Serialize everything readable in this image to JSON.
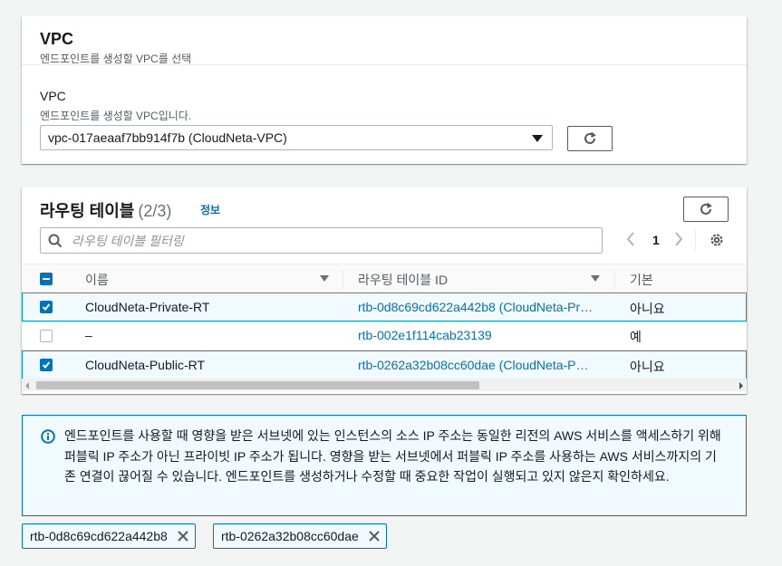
{
  "vpc_section": {
    "title": "VPC",
    "description": "엔드포인트를 생성할 VPC를 선택",
    "field_label": "VPC",
    "field_description": "엔드포인트를 생성할 VPC입니다.",
    "selected_vpc": "vpc-017aeaaf7bb914f7b (CloudNeta-VPC)"
  },
  "route_tables": {
    "title": "라우팅 테이블",
    "count": "(2/3)",
    "info_link": "정보",
    "search_placeholder": "라우팅 테이블 필터링",
    "current_page": "1",
    "columns": [
      "이름",
      "라우팅 테이블 ID",
      "기본"
    ],
    "rows": [
      {
        "checked": true,
        "name": "CloudNeta-Private-RT",
        "id": "rtb-0d8c69cd622a442b8 (CloudNeta-Pr…",
        "main": "아니요"
      },
      {
        "checked": false,
        "name": "–",
        "id": "rtb-002e1f114cab23139",
        "main": "예"
      },
      {
        "checked": true,
        "name": "CloudNeta-Public-RT",
        "id": "rtb-0262a32b08cc60dae (CloudNeta-P…",
        "main": "아니요"
      }
    ]
  },
  "alert": {
    "text": "엔드포인트를 사용할 때 영향을 받은 서브넷에 있는 인스턴스의 소스 IP 주소는 동일한 리전의 AWS 서비스를 액세스하기 위해 퍼블릭 IP 주소가 아닌 프라이빗 IP 주소가 됩니다. 영향을 받는 서브넷에서 퍼블릭 IP 주소를 사용하는 AWS 서비스까지의 기존 연결이 끊어질 수 있습니다. 엔드포인트를 생성하거나 수정할 때 중요한 작업이 실행되고 있지 않은지 확인하세요."
  },
  "tokens": [
    "rtb-0d8c69cd622a442b8",
    "rtb-0262a32b08cc60dae"
  ],
  "colors": {
    "accent": "#0073bb",
    "link": "#0073bb",
    "selected_bg": "#f1faff",
    "selected_border": "#00a1c9"
  }
}
